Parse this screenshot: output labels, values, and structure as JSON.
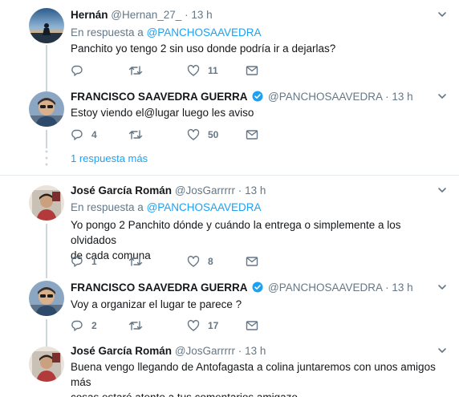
{
  "tweets": [
    {
      "name": "Hernán",
      "handle": "@Hernan_27_",
      "dot": "·",
      "time": "13 h",
      "reply_prefix": "En respuesta a",
      "reply_mention": "@PANCHOSAAVEDRA",
      "text": "Panchito yo tengo 2 sin uso donde podría ir a dejarlas?",
      "replies": "",
      "retweets": "",
      "likes": "11"
    },
    {
      "name": "FRANCISCO SAAVEDRA GUERRA",
      "verified": true,
      "handle": "@PANCHOSAAVEDRA",
      "dot": "·",
      "time": "13 h",
      "text": "Estoy viendo el@lugar luego les aviso",
      "replies": "4",
      "retweets": "",
      "likes": "50"
    },
    {
      "name": "José García Román",
      "handle": "@JosGarrrrr",
      "dot": "·",
      "time": "13 h",
      "reply_prefix": "En respuesta a",
      "reply_mention": "@PANCHOSAAVEDRA",
      "text_line1": "Yo pongo 2 Panchito dónde y cuándo la entrega o simplemente a los olvidados",
      "text_line2": "de cada comuna",
      "replies": "1",
      "retweets": "",
      "likes": "8"
    },
    {
      "name": "FRANCISCO SAAVEDRA GUERRA",
      "verified": true,
      "handle": "@PANCHOSAAVEDRA",
      "dot": "·",
      "time": "13 h",
      "text": "Voy a organizar el lugar te parece ?",
      "replies": "2",
      "retweets": "",
      "likes": "17"
    },
    {
      "name": "José García Román",
      "handle": "@JosGarrrrr",
      "dot": "·",
      "time": "13 h",
      "text_line1": "Buena vengo llegando de Antofagasta a colina juntaremos con unos amigos más",
      "text_line2": "cosas estaré atento a tus comentarios amigazo"
    }
  ],
  "more_replies_link": "1 respuesta más",
  "colors": {
    "link": "#1da1f2",
    "muted": "#657786",
    "verified": "#1da1f2",
    "divider": "#e6ecf0"
  }
}
